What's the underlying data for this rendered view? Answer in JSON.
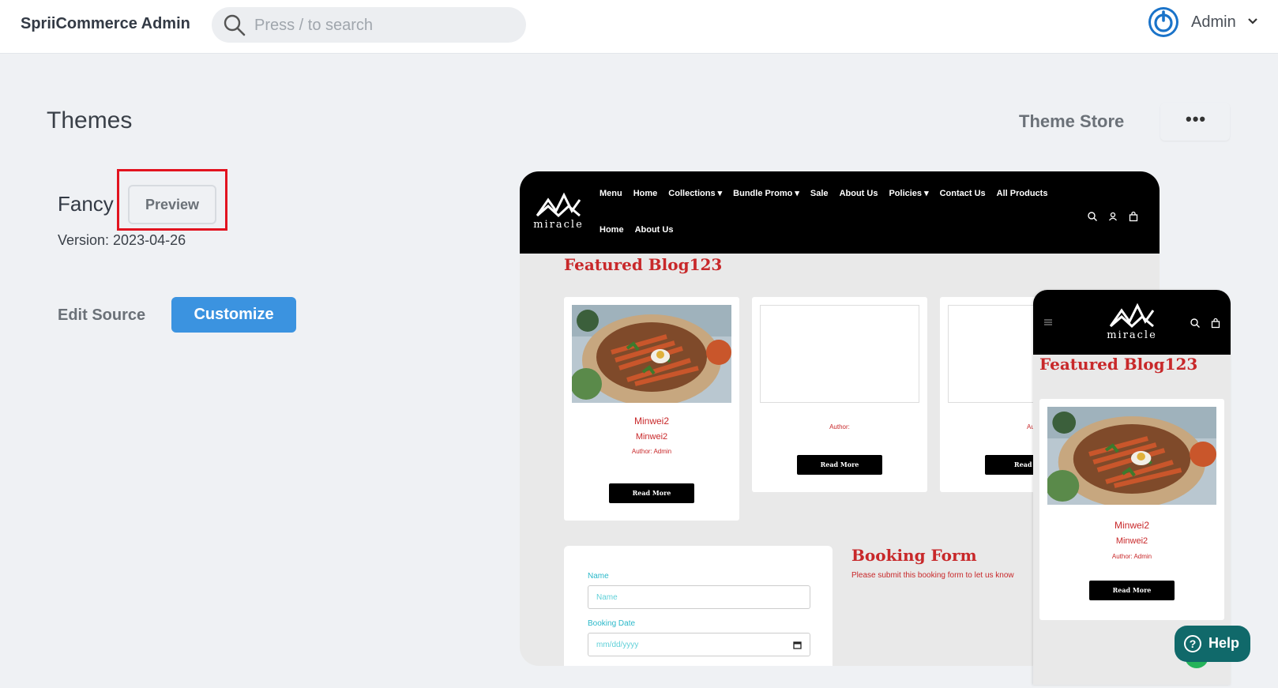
{
  "header": {
    "brand": "SpriiCommerce Admin",
    "search_placeholder": "Press / to search",
    "user_name": "Admin"
  },
  "page": {
    "title": "Themes",
    "theme_store_label": "Theme Store",
    "more_label": "•••"
  },
  "theme": {
    "name": "Fancy",
    "preview_label": "Preview",
    "version": "Version: 2023-04-26",
    "edit_source_label": "Edit Source",
    "customize_label": "Customize"
  },
  "preview_site": {
    "logo_text": "miracle",
    "nav_row1": [
      "Menu",
      "Home",
      "Collections",
      "Bundle Promo",
      "Sale",
      "About Us",
      "Policies",
      "Contact Us",
      "All Products"
    ],
    "nav_row2": [
      "Home",
      "About Us"
    ],
    "featured_title": "Featured Blog123",
    "cards": [
      {
        "title": "Minwei2",
        "subtitle": "Minwei2",
        "author": "Author: Admin",
        "button": "Read More"
      },
      {
        "author": "Author:",
        "button": "Read More"
      },
      {
        "author": "Autho",
        "button": "Read M"
      }
    ],
    "form": {
      "name_label": "Name",
      "name_placeholder": "Name",
      "date_label": "Booking Date",
      "date_placeholder": "mm/dd/yyyy"
    },
    "booking_title": "Booking Form",
    "booking_sub": "Please submit this booking form to let us know"
  },
  "mobile_preview": {
    "logo_text": "miracle",
    "featured_title": "Featured Blog123",
    "card": {
      "title": "Minwei2",
      "subtitle": "Minwei2",
      "author": "Author: Admin",
      "button": "Read More"
    }
  },
  "help_label": "Help",
  "colors": {
    "accent": "#3b93e0",
    "highlight": "#e2131f",
    "site_red": "#c8282a",
    "help_bg": "#10696a"
  }
}
